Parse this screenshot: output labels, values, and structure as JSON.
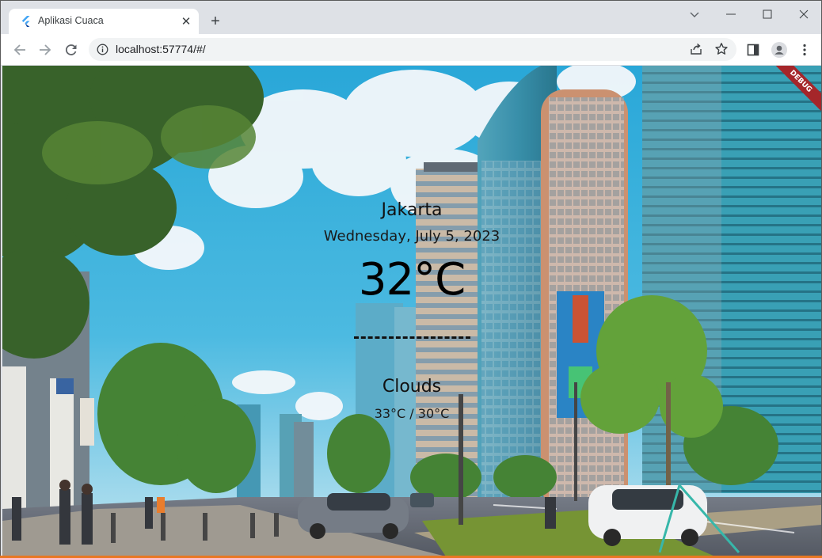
{
  "browser": {
    "tab": {
      "title": "Aplikasi Cuaca",
      "close_glyph": "✕",
      "favicon": "flutter-logo-icon"
    },
    "new_tab_glyph": "+",
    "address": {
      "url": "localhost:57774/#/"
    },
    "colors": {
      "tabstrip": "#dee1e6",
      "toolbar": "#ffffff",
      "omnibox": "#f1f3f4"
    }
  },
  "weather": {
    "city": "Jakarta",
    "date": "Wednesday, July 5, 2023",
    "temperature": "32°C",
    "condition": "Clouds",
    "min_max": "33°C / 30°C"
  },
  "debug_banner": {
    "label": "DEBUG",
    "color": "#a5262a"
  }
}
